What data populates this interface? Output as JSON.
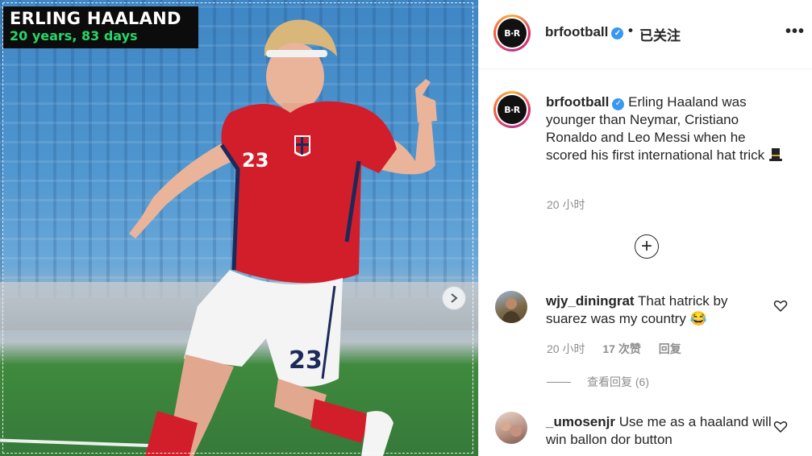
{
  "photo": {
    "title_name": "ERLING HAALAND",
    "title_age": "20 years, 83 days",
    "jersey_number": "23",
    "next_icon": "chevron-right-icon"
  },
  "header": {
    "username": "brfootball",
    "avatar_text": "B·R",
    "separator": "•",
    "follow_status": "已关注",
    "more_label": "•••"
  },
  "caption": {
    "username": "brfootball",
    "text": "Erling Haaland was younger than Neymar, Cristiano Ronaldo and Leo Messi when he scored his first international hat trick",
    "emoji": "top-hat-icon",
    "time": "20 小时"
  },
  "load_more_label": "+",
  "comments": [
    {
      "username": "wjy_diningrat",
      "text": "That hatrick by suarez was my country",
      "emoji": "😂",
      "time": "20 小时",
      "likes": "17 次赞",
      "reply_label": "回复",
      "view_replies": "查看回复 (6)"
    },
    {
      "username": "_umosenjr",
      "text": "Use me as a haaland will win ballon dor button"
    }
  ],
  "colors": {
    "accent": "#3897f0",
    "secondary_text": "#8e8e8e",
    "jersey_red": "#d21e2b",
    "age_green": "#27d66a"
  }
}
